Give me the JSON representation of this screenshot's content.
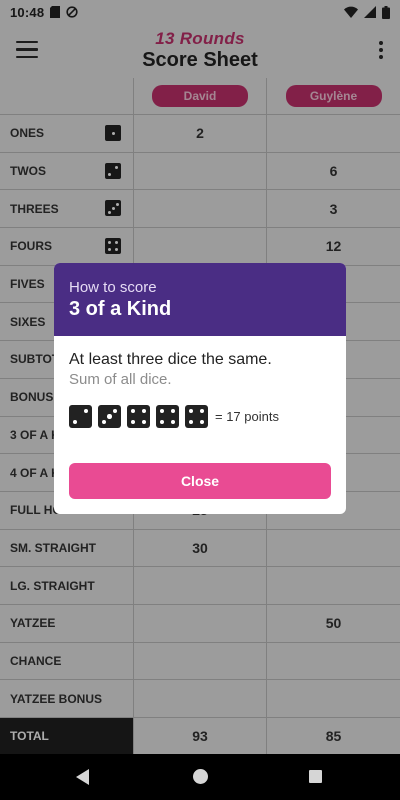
{
  "status_bar": {
    "time": "10:48"
  },
  "app_bar": {
    "title_top": "13 Rounds",
    "title_bottom": "Score Sheet"
  },
  "players": [
    "David",
    "Guylène"
  ],
  "rows": [
    {
      "label": "ONES",
      "die": 1,
      "values": [
        "2",
        ""
      ]
    },
    {
      "label": "TWOS",
      "die": 2,
      "values": [
        "",
        "6"
      ]
    },
    {
      "label": "THREES",
      "die": 3,
      "values": [
        "",
        "3"
      ]
    },
    {
      "label": "FOURS",
      "die": 4,
      "values": [
        "",
        "12"
      ]
    },
    {
      "label": "FIVES",
      "die": 5,
      "values": [
        "",
        ""
      ]
    },
    {
      "label": "SIXES",
      "die": 6,
      "values": [
        "",
        ""
      ]
    },
    {
      "label": "SUBTOT",
      "die": 0,
      "values": [
        "",
        ""
      ]
    },
    {
      "label": "BONUS",
      "die": 0,
      "values": [
        "",
        ""
      ]
    },
    {
      "label": "3 OF A K",
      "die": 0,
      "values": [
        "",
        ""
      ]
    },
    {
      "label": "4 OF A K",
      "die": 0,
      "values": [
        "",
        ""
      ]
    },
    {
      "label": "FULL HOUSE",
      "die": 0,
      "values": [
        "25",
        ""
      ]
    },
    {
      "label": "SM. STRAIGHT",
      "die": 0,
      "values": [
        "30",
        ""
      ]
    },
    {
      "label": "LG. STRAIGHT",
      "die": 0,
      "values": [
        "",
        ""
      ]
    },
    {
      "label": "YATZEE",
      "die": 0,
      "values": [
        "",
        "50"
      ]
    },
    {
      "label": "CHANCE",
      "die": 0,
      "values": [
        "",
        ""
      ]
    },
    {
      "label": "YATZEE BONUS",
      "die": 0,
      "values": [
        "",
        ""
      ]
    }
  ],
  "total": {
    "label": "TOTAL",
    "values": [
      "93",
      "85"
    ]
  },
  "dialog": {
    "subtitle": "How to score",
    "title": "3 of a Kind",
    "description": "At least three dice the same.",
    "subdescription": "Sum of all dice.",
    "example_dice": [
      2,
      3,
      4,
      4,
      4
    ],
    "points_text": "= 17 points",
    "close_label": "Close"
  },
  "colors": {
    "accent": "#c0306a",
    "dialog_header": "#4a2d84",
    "button": "#e94b93"
  }
}
